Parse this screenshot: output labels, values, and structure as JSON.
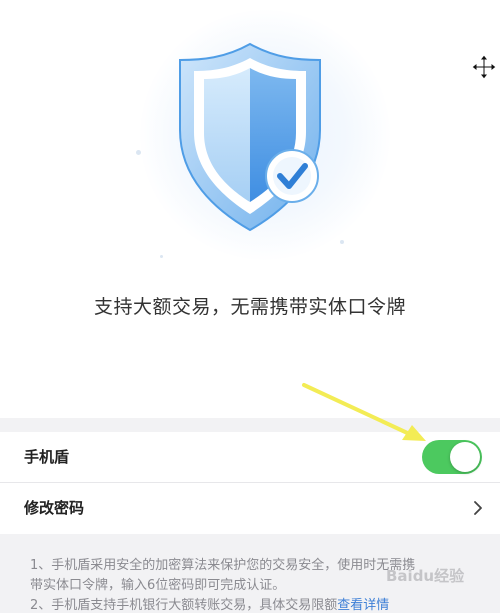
{
  "hero": {
    "tagline": "支持大额交易，无需携带实体口令牌",
    "shield_icon": "shield-check-icon",
    "colors": {
      "shield_light": "#a9d2f6",
      "shield_dark": "#3f8ee2",
      "halo": "#eaf3fd"
    }
  },
  "settings": {
    "mobile_shield": {
      "label": "手机盾",
      "enabled": true,
      "toggle_color": "#4cc95f"
    },
    "change_password": {
      "label": "修改密码"
    }
  },
  "notes": {
    "line1a": "1、手机盾采用安全的加密算法来保护您的交易安全，使用时无需携",
    "line1b": "带实体口令牌，输入6位密码即可完成认证。",
    "line2": "2、手机盾支持手机银行大额转账交易，具体交易限额",
    "line2_link": "查看详情"
  },
  "watermark": "Baidu经验",
  "annotation_color": "#f3ec55"
}
